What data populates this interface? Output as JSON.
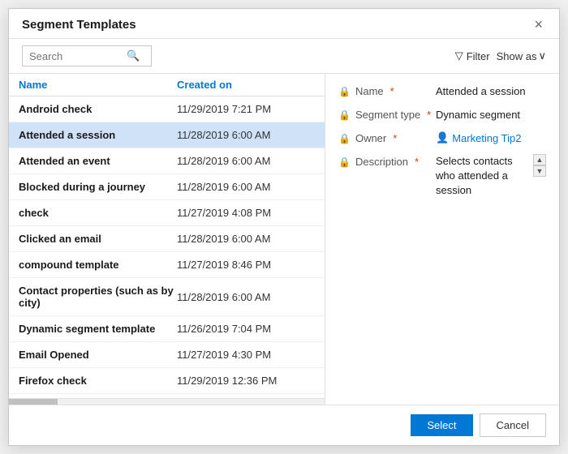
{
  "dialog": {
    "title": "Segment Templates",
    "close_label": "×"
  },
  "toolbar": {
    "search_placeholder": "Search",
    "filter_label": "Filter",
    "show_as_label": "Show as",
    "filter_icon": "▽"
  },
  "list": {
    "header_name": "Name",
    "header_created": "Created on",
    "rows": [
      {
        "name": "Android check",
        "date": "11/29/2019 7:21 PM",
        "selected": false
      },
      {
        "name": "Attended a session",
        "date": "11/28/2019 6:00 AM",
        "selected": true
      },
      {
        "name": "Attended an event",
        "date": "11/28/2019 6:00 AM",
        "selected": false
      },
      {
        "name": "Blocked during a journey",
        "date": "11/28/2019 6:00 AM",
        "selected": false
      },
      {
        "name": "check",
        "date": "11/27/2019 4:08 PM",
        "selected": false
      },
      {
        "name": "Clicked an email",
        "date": "11/28/2019 6:00 AM",
        "selected": false
      },
      {
        "name": "compound template",
        "date": "11/27/2019 8:46 PM",
        "selected": false
      },
      {
        "name": "Contact properties (such as by city)",
        "date": "11/28/2019 6:00 AM",
        "selected": false
      },
      {
        "name": "Dynamic segment template",
        "date": "11/26/2019 7:04 PM",
        "selected": false
      },
      {
        "name": "Email Opened",
        "date": "11/27/2019 4:30 PM",
        "selected": false
      },
      {
        "name": "Firefox check",
        "date": "11/29/2019 12:36 PM",
        "selected": false
      }
    ]
  },
  "detail": {
    "name_label": "Name",
    "name_value": "Attended a session",
    "segment_type_label": "Segment type",
    "segment_type_value": "Dynamic segment",
    "owner_label": "Owner",
    "owner_value": "Marketing Tip2",
    "description_label": "Description",
    "description_value": "Selects contacts who attended a session"
  },
  "footer": {
    "select_label": "Select",
    "cancel_label": "Cancel"
  }
}
